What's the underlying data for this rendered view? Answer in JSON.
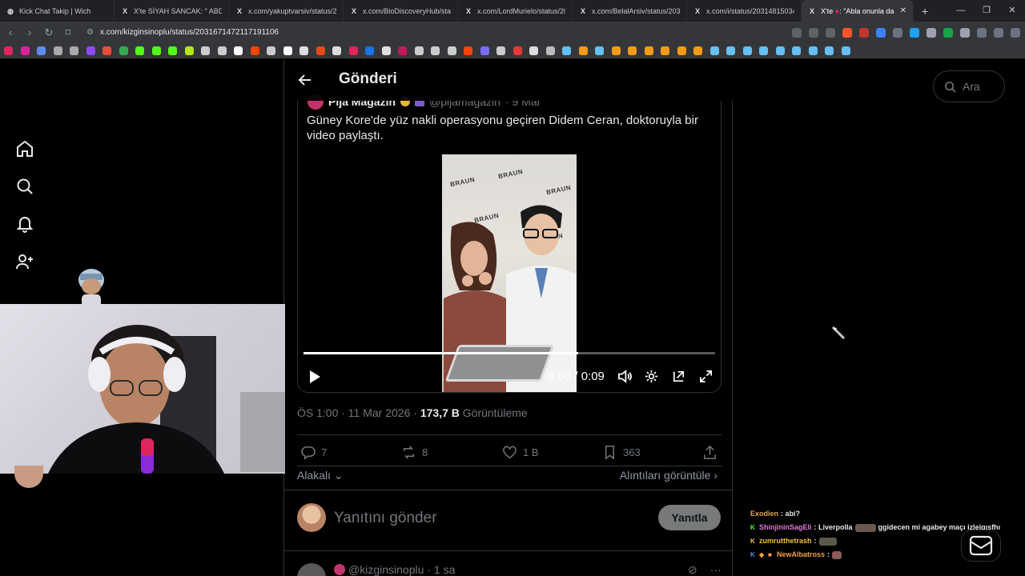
{
  "browser": {
    "tabs": [
      {
        "label": "Kick Chat Takip | Wich",
        "active": false
      },
      {
        "label": "X'te SİYAH SANCAK: \"",
        "suffix": "ABD'",
        "active": false
      },
      {
        "label": "x.com/yakuptvarsiv/status/203",
        "active": false
      },
      {
        "label": "x.com/BioDiscoveryHub/status",
        "active": false
      },
      {
        "label": "x.com/LordMurielo/status/203",
        "active": false
      },
      {
        "label": "x.com/BelalArsiv/status/20314",
        "active": false
      },
      {
        "label": "x.com/i/status/2031481503406",
        "active": false
      },
      {
        "label": "X'te",
        "suffix": ": \"Abla onunla da k",
        "active": true
      }
    ],
    "url": "x.com/kizginsinoplu/status/2031671472117191106"
  },
  "page": {
    "header_title": "Gönderi",
    "search_placeholder": "Ara",
    "quoted": {
      "author_name": "Pija Magazin",
      "handle": "@pijamagazin",
      "time": "· 9 Mar",
      "text": "Güney Kore'de yüz nakli operasyonu geçiren Didem Ceran, doktoruyla bir video paylaştı.",
      "video": {
        "time_display": "0:06 / 0:09",
        "progress_fraction": 0.667,
        "brand_text": "BRAUN"
      }
    },
    "meta": {
      "timestamp": "ÖS 1:00 · 11 Mar 2026 · ",
      "views_value": "173,7 B",
      "views_label": " Görüntüleme"
    },
    "actions": {
      "replies": "7",
      "reposts": "8",
      "likes": "1 B",
      "bookmarks": "363"
    },
    "related_label": "Alakalı",
    "view_quotes_label": "Alıntıları görüntüle",
    "reply_placeholder": "Yanıtını gönder",
    "reply_button": "Yanıtla",
    "next_post": {
      "handle": "@kizginsinoplu",
      "time": "· 1 sa"
    }
  },
  "chat": [
    {
      "user": "Exodien",
      "color": "#e0a84a",
      "text": ": abi?"
    },
    {
      "user": "ShinjininSagEli",
      "color": "#e279d6",
      "text": ": Liverpolla",
      "after": "ggidecen mi agabey maçı izlejgısfhı"
    },
    {
      "user": "zumrutthetrash",
      "color": "#f2c02e",
      "text": ":"
    },
    {
      "user": "NewAlbatross",
      "color": "#f5a142",
      "text": ":"
    }
  ]
}
